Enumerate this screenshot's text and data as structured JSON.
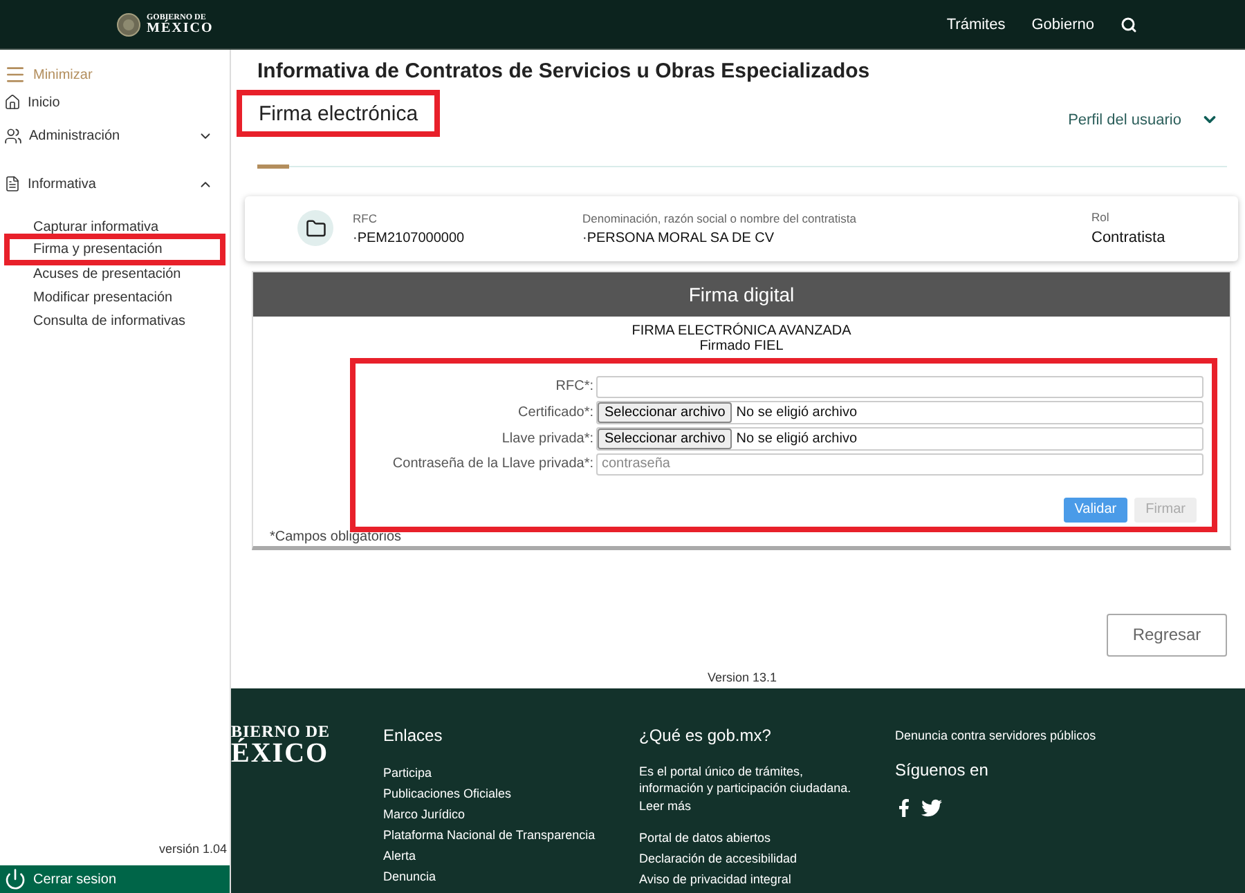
{
  "header": {
    "logo": [
      "GOBIERNO DE",
      "MÉXICO"
    ],
    "nav": [
      "Trámites",
      "Gobierno"
    ]
  },
  "sidebar": {
    "minimize": "Minimizar",
    "items": [
      {
        "label": "Inicio",
        "kind": "home"
      },
      {
        "label": "Administración",
        "kind": "people",
        "expanded": false
      },
      {
        "label": "Informativa",
        "kind": "form",
        "expanded": true,
        "children": [
          {
            "label": "Capturar informativa",
            "highlighted": false
          },
          {
            "label": "Firma y presentación",
            "highlighted": true
          },
          {
            "label": "Acuses de presentación",
            "highlighted": false
          },
          {
            "label": "Modificar presentación",
            "highlighted": false
          },
          {
            "label": "Consulta de informativas",
            "highlighted": false
          }
        ]
      }
    ],
    "version": "versión 1.04",
    "logout": "Cerrar sesion"
  },
  "page": {
    "title": "Informativa de Contratos de Servicios u Obras Especializados",
    "subtitle": "Firma electrónica",
    "subtitle_highlighted": true,
    "profile": "Perfil del usuario"
  },
  "card": {
    "fields": [
      {
        "label": "RFC",
        "value": "·PEM2107000000"
      },
      {
        "label": "Denominación, razón social o nombre del contratista",
        "value": "·PERSONA MORAL SA DE CV"
      },
      {
        "label": "Rol",
        "value": "Contratista"
      }
    ]
  },
  "signature": {
    "title": "Firma digital",
    "heading": [
      "FIRMA ELECTRÓNICA AVANZADA",
      "Firmado FIEL"
    ],
    "highlighted": true,
    "fields": [
      {
        "label": "RFC*:",
        "kind": "text"
      },
      {
        "label": "Certificado*:",
        "kind": "file",
        "button": "Seleccionar archivo",
        "value": "No se eligió archivo"
      },
      {
        "label": "Llave privada*:",
        "kind": "file",
        "button": "Seleccionar archivo",
        "value": "No se eligió archivo"
      },
      {
        "label": "Contraseña de la Llave privada*:",
        "kind": "password",
        "placeholder": "contraseña"
      }
    ],
    "buttons": [
      {
        "label": "Validar",
        "disabled": false
      },
      {
        "label": "Firmar",
        "disabled": true
      }
    ],
    "note": "*Campos obligatorios"
  },
  "back_button": "Regresar",
  "version": "Version 13.1",
  "footer": {
    "logo": [
      "BIERNO DE",
      "ÉXICO"
    ],
    "columns": [
      {
        "title": "Enlaces",
        "groups": [
          [
            "Participa",
            "Publicaciones Oficiales",
            "Marco Jurídico",
            "Plataforma Nacional de Transparencia",
            "Alerta",
            "Denuncia"
          ]
        ]
      },
      {
        "title": "¿Qué es gob.mx?",
        "groups": [
          [
            "Es el portal único de trámites, información y participación ciudadana.",
            "Leer más"
          ],
          [
            "Portal de datos abiertos",
            "Declaración de accesibilidad",
            "Aviso de privacidad integral"
          ]
        ]
      },
      {
        "heading": "Denuncia contra servidores públicos",
        "title": "Síguenos en",
        "social": [
          {
            "kind": "facebook"
          },
          {
            "kind": "twitter"
          }
        ]
      }
    ]
  }
}
